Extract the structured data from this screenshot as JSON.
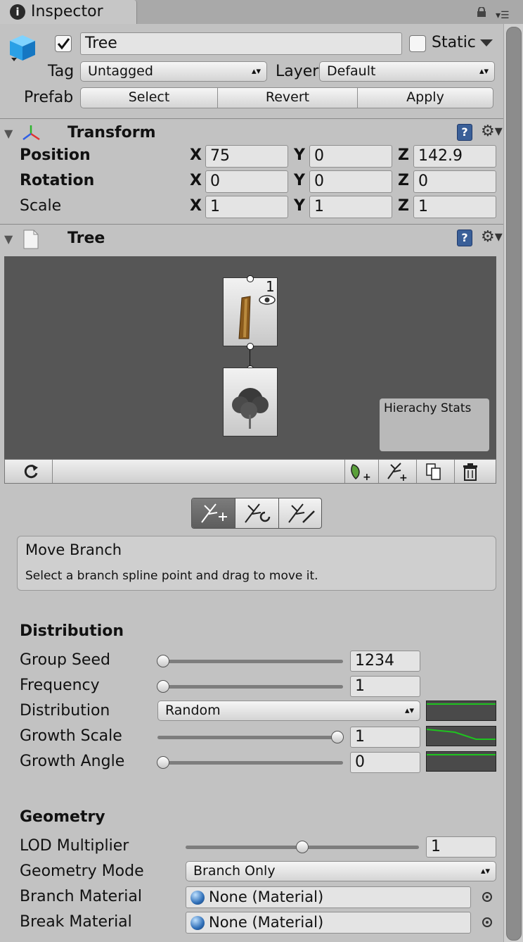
{
  "window": {
    "tab_title": "Inspector"
  },
  "object": {
    "active": true,
    "name": "Tree",
    "static_label": "Static",
    "static_checked": false,
    "tag_label": "Tag",
    "tag_value": "Untagged",
    "layer_label": "Layer",
    "layer_value": "Default",
    "prefab_label": "Prefab",
    "prefab_buttons": {
      "select": "Select",
      "revert": "Revert",
      "apply": "Apply"
    }
  },
  "transform": {
    "title": "Transform",
    "rows": [
      {
        "label": "Position",
        "x": "75",
        "y": "0",
        "z": "142.9"
      },
      {
        "label": "Rotation",
        "x": "0",
        "y": "0",
        "z": "0"
      },
      {
        "label": "Scale",
        "x": "1",
        "y": "1",
        "z": "1"
      }
    ],
    "axis": {
      "x": "X",
      "y": "Y",
      "z": "Z"
    }
  },
  "tree": {
    "title": "Tree",
    "node_count": "1",
    "stats_label": "Hierachy Stats",
    "help_title": "Move Branch",
    "help_text": "Select a branch spline point and drag to move it."
  },
  "distribution": {
    "title": "Distribution",
    "group_seed_label": "Group Seed",
    "group_seed_value": "1234",
    "group_seed_fraction": 0.0,
    "frequency_label": "Frequency",
    "frequency_value": "1",
    "frequency_fraction": 0.0,
    "distribution_label": "Distribution",
    "distribution_value": "Random",
    "growth_scale_label": "Growth Scale",
    "growth_scale_value": "1",
    "growth_scale_fraction": 1.0,
    "growth_angle_label": "Growth Angle",
    "growth_angle_value": "0",
    "growth_angle_fraction": 0.0
  },
  "geometry": {
    "title": "Geometry",
    "lod_label": "LOD Multiplier",
    "lod_value": "1",
    "lod_fraction": 0.5,
    "mode_label": "Geometry Mode",
    "mode_value": "Branch Only",
    "branch_material_label": "Branch Material",
    "branch_material_value": "None (Material)",
    "break_material_label": "Break Material",
    "break_material_value": "None (Material)"
  },
  "colors": {
    "curve_line": "#1fc31f",
    "help_icon": "#3a5f98"
  }
}
